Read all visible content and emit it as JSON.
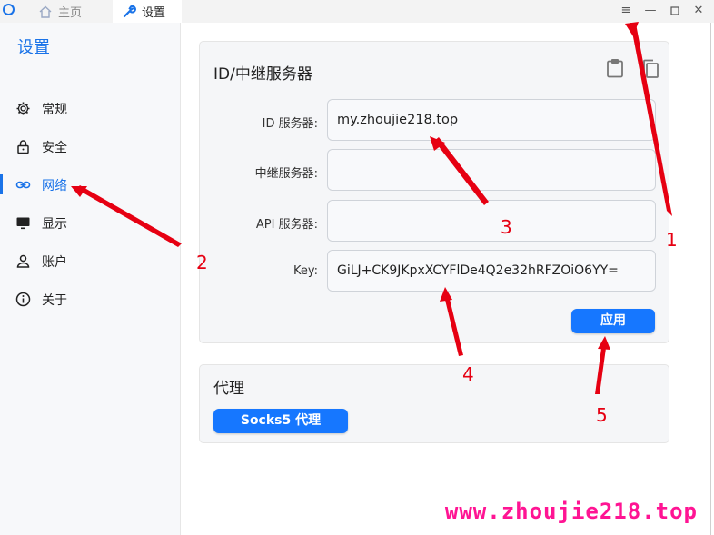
{
  "tabs": {
    "home": "主页",
    "settings": "设置"
  },
  "sidebar": {
    "title": "设置",
    "items": [
      {
        "label": "常规",
        "icon": "gear-icon"
      },
      {
        "label": "安全",
        "icon": "lock-icon"
      },
      {
        "label": "网络",
        "icon": "link-icon",
        "active": true
      },
      {
        "label": "显示",
        "icon": "monitor-icon"
      },
      {
        "label": "账户",
        "icon": "user-icon"
      },
      {
        "label": "关于",
        "icon": "info-icon"
      }
    ]
  },
  "server_card": {
    "title": "ID/中继服务器",
    "fields": {
      "id_label": "ID 服务器:",
      "id_value": "my.zhoujie218.top",
      "relay_label": "中继服务器:",
      "relay_value": "",
      "api_label": "API 服务器:",
      "api_value": "",
      "key_label": "Key:",
      "key_value": "GiLJ+CK9JKpxXCYFlDe4Q2e32hRFZOiO6YY="
    },
    "apply_label": "应用"
  },
  "proxy_card": {
    "title": "代理",
    "socks5_label": "Socks5 代理"
  },
  "annotations": {
    "n1": "1",
    "n2": "2",
    "n3": "3",
    "n4": "4",
    "n5": "5"
  },
  "watermark": "www.zhoujie218.top",
  "colors": {
    "accent": "#1a73e8",
    "button": "#1677ff",
    "annotation": "#e60012",
    "watermark": "#ff1493"
  }
}
